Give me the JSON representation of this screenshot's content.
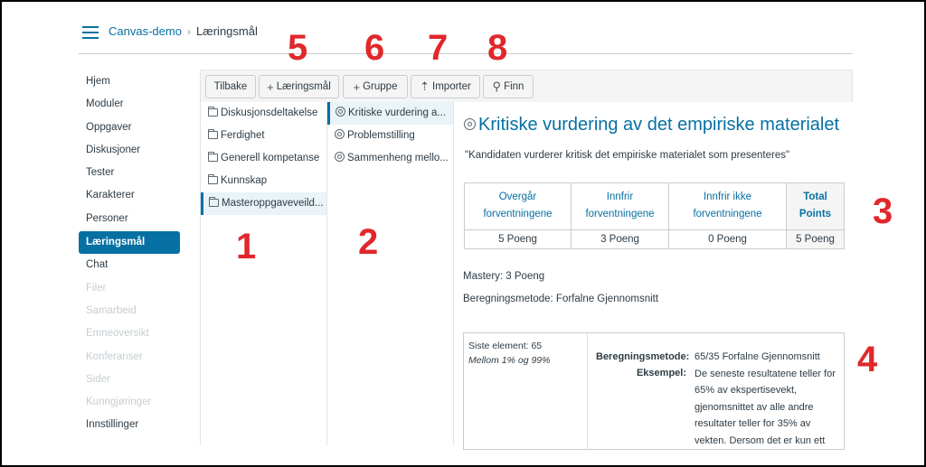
{
  "header": {
    "course": "Canvas-demo",
    "separator": "›",
    "current_page": "Læringsmål"
  },
  "nav": {
    "items": [
      {
        "label": "Hjem",
        "state": "normal"
      },
      {
        "label": "Moduler",
        "state": "normal"
      },
      {
        "label": "Oppgaver",
        "state": "normal"
      },
      {
        "label": "Diskusjoner",
        "state": "normal"
      },
      {
        "label": "Tester",
        "state": "normal"
      },
      {
        "label": "Karakterer",
        "state": "normal"
      },
      {
        "label": "Personer",
        "state": "normal"
      },
      {
        "label": "Læringsmål",
        "state": "active"
      },
      {
        "label": "Chat",
        "state": "normal"
      },
      {
        "label": "Filer",
        "state": "disabled"
      },
      {
        "label": "Samarbeid",
        "state": "disabled"
      },
      {
        "label": "Emneoversikt",
        "state": "disabled"
      },
      {
        "label": "Konferanser",
        "state": "disabled"
      },
      {
        "label": "Sider",
        "state": "disabled"
      },
      {
        "label": "Kunngjøringer",
        "state": "disabled"
      },
      {
        "label": "Innstillinger",
        "state": "normal"
      }
    ]
  },
  "toolbar": {
    "back_label": "Tilbake",
    "outcome_label": "Læringsmål",
    "group_label": "Gruppe",
    "import_label": "Importer",
    "find_label": "Finn"
  },
  "annotations": [
    "1",
    "2",
    "3",
    "4",
    "5",
    "6",
    "7",
    "8"
  ],
  "groups": [
    {
      "label": "Diskusjonsdeltakelse",
      "selected": false
    },
    {
      "label": "Ferdighet",
      "selected": false
    },
    {
      "label": "Generell kompetanse",
      "selected": false
    },
    {
      "label": "Kunnskap",
      "selected": false
    },
    {
      "label": "Masteroppgaveveild...",
      "selected": true
    }
  ],
  "outcomes": [
    {
      "label": "Kritiske vurdering a...",
      "selected": true
    },
    {
      "label": "Problemstilling",
      "selected": false
    },
    {
      "label": "Sammenheng mello...",
      "selected": false
    }
  ],
  "detail": {
    "title": "Kritiske vurdering av det empiriske materialet",
    "description": "\"Kandidaten vurderer kritisk det empiriske materialet som presenteres\"",
    "rubric": {
      "headers": [
        "Overgår forventningene",
        "Innfrir forventningene",
        "Innfrir ikke forventningene",
        "Total Points"
      ],
      "values": [
        "5 Poeng",
        "3 Poeng",
        "0 Poeng",
        "5 Poeng"
      ]
    },
    "mastery": "Mastery: 3 Poeng",
    "calculation_method": "Beregningsmetode: Forfalne Gjennomsnitt",
    "box": {
      "last_item": "Siste element: 65",
      "range": "Mellom 1% og 99%",
      "method_label": "Beregningsmetode:",
      "example_label": "Eksempel:",
      "method_value": "65/35 Forfalne Gjennomsnitt",
      "example_text": "De seneste resultatene teller for 65% av ekspertisevekt, gjenomsnittet av alle andre resultater teller for 35% av vekten. Dersom det er kun ett"
    }
  }
}
